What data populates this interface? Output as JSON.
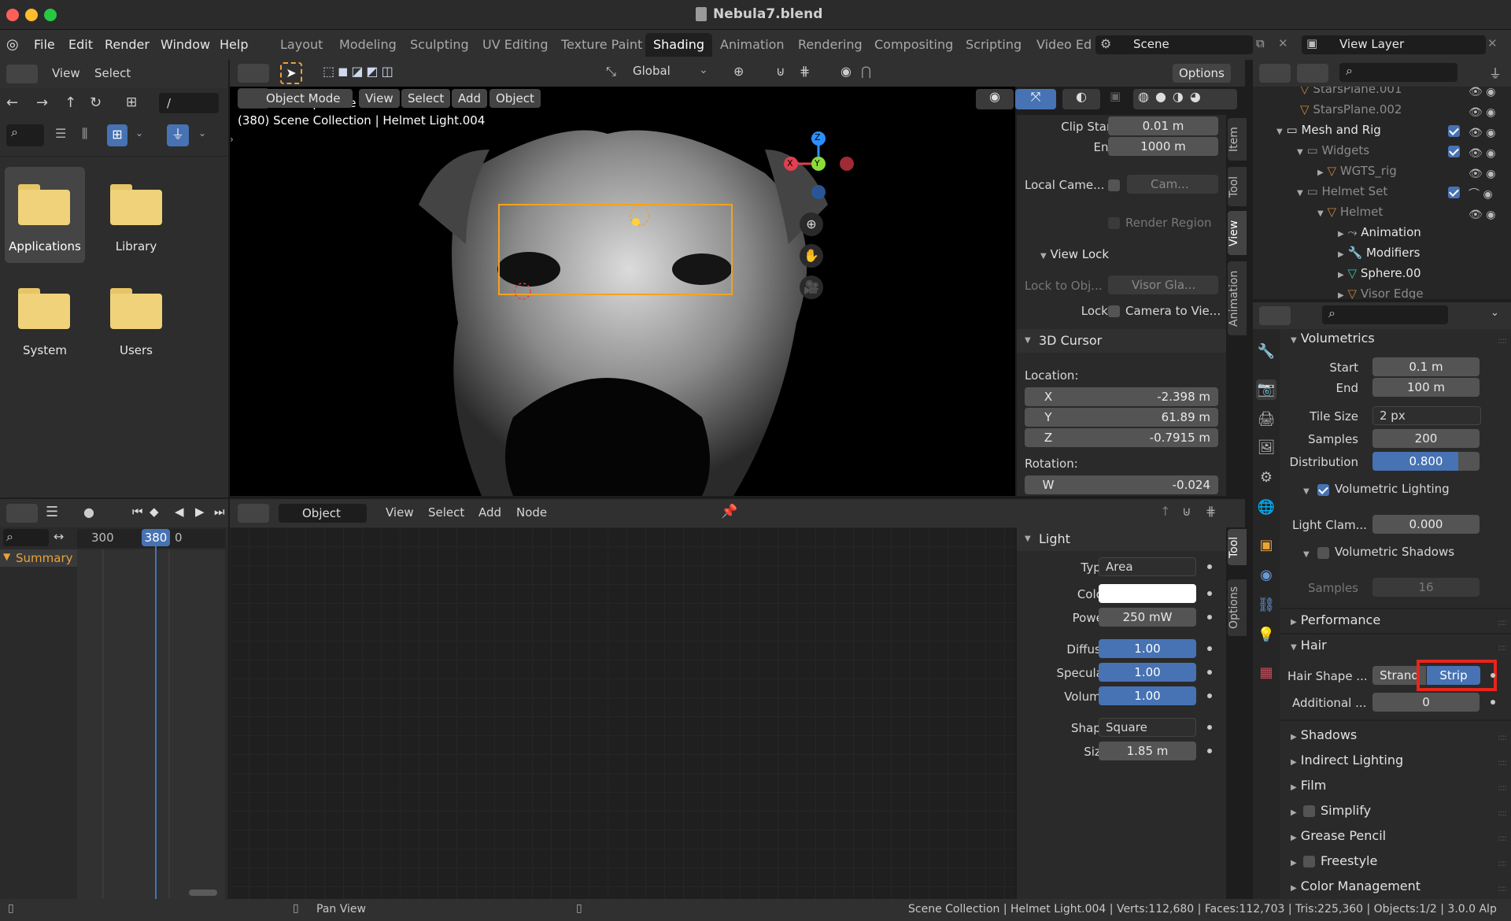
{
  "window": {
    "title": "Nebula7.blend"
  },
  "menu": [
    "File",
    "Edit",
    "Render",
    "Window",
    "Help"
  ],
  "workspaces": [
    {
      "label": "Layout",
      "active": false
    },
    {
      "label": "Modeling",
      "active": false
    },
    {
      "label": "Sculpting",
      "active": false
    },
    {
      "label": "UV Editing",
      "active": false
    },
    {
      "label": "Texture Paint",
      "active": false
    },
    {
      "label": "Shading",
      "active": true
    },
    {
      "label": "Animation",
      "active": false
    },
    {
      "label": "Rendering",
      "active": false
    },
    {
      "label": "Compositing",
      "active": false
    },
    {
      "label": "Scripting",
      "active": false
    },
    {
      "label": "Video Ed",
      "active": false
    }
  ],
  "scene": {
    "name": "Scene"
  },
  "view_layer": {
    "name": "View Layer"
  },
  "file_browser": {
    "header": {
      "view": "View",
      "select": "Select"
    },
    "path": "/",
    "items": [
      {
        "label": "Applications",
        "selected": true
      },
      {
        "label": "Library",
        "selected": false
      },
      {
        "label": "System",
        "selected": false
      },
      {
        "label": "Users",
        "selected": false
      }
    ]
  },
  "viewport": {
    "toolbar": {
      "orientation": "Global",
      "options": "Options"
    },
    "header": {
      "mode": "Object Mode",
      "view": "View",
      "select": "Select",
      "add": "Add",
      "object": "Object"
    },
    "overlay_lines": [
      "Camera Perspective",
      "(380) Scene Collection | Helmet Light.004"
    ],
    "gizmo": {
      "x": "X",
      "y": "Y",
      "z": "Z"
    },
    "sidebar": {
      "tabs": [
        "Item",
        "Tool",
        "View",
        "Animation"
      ],
      "clip_start_label": "Clip Start",
      "clip_start": "0.01 m",
      "clip_end_label": "End",
      "clip_end": "1000 m",
      "local_camera_label": "Local Came...",
      "local_camera_value": "Cam...",
      "render_region": "Render Region",
      "view_lock": "View Lock",
      "lock_to_obj_label": "Lock to Obj...",
      "lock_to_obj_value": "Visor Gla...",
      "lock_label": "Lock",
      "camera_to_view": "Camera to Vie...",
      "cursor_title": "3D Cursor",
      "location_label": "Location:",
      "x_label": "X",
      "x": "-2.398 m",
      "y_label": "Y",
      "y": "61.89 m",
      "z_label": "Z",
      "z": "-0.7915 m",
      "rotation_label": "Rotation:",
      "w_label": "W",
      "w": "-0.024"
    }
  },
  "timeline": {
    "frame_a": "300",
    "current": "380",
    "frame_b": "0",
    "summary": "Summary"
  },
  "node_editor": {
    "header": {
      "type": "Object",
      "view": "View",
      "select": "Select",
      "add": "Add",
      "node": "Node"
    },
    "tabs": [
      "Tool",
      "Options"
    ],
    "light": {
      "title": "Light",
      "type_label": "Type",
      "type": "Area",
      "color_label": "Color",
      "color": "#ffffff",
      "power_label": "Power",
      "power": "250 mW",
      "diffuse_label": "Diffuse",
      "diffuse": "1.00",
      "specular_label": "Specular",
      "specular": "1.00",
      "volume_label": "Volume",
      "volume": "1.00",
      "shape_label": "Shape",
      "shape": "Square",
      "size_label": "Size",
      "size": "1.85 m"
    }
  },
  "outliner": {
    "rows": [
      {
        "label": "StarsPlane.001",
        "dim": true
      },
      {
        "label": "StarsPlane.002",
        "dim": true
      },
      {
        "label": "Mesh and Rig",
        "dim": false
      },
      {
        "label": "Widgets",
        "dim": true
      },
      {
        "label": "WGTS_rig",
        "dim": true
      },
      {
        "label": "Helmet Set",
        "dim": true
      },
      {
        "label": "Helmet",
        "dim": true
      },
      {
        "label": "Animation",
        "dim": false
      },
      {
        "label": "Modifiers",
        "dim": false
      },
      {
        "label": "Sphere.00",
        "dim": false
      },
      {
        "label": "Visor Edge",
        "dim": true
      }
    ]
  },
  "properties": {
    "volumetrics": "Volumetrics",
    "start_label": "Start",
    "start": "0.1 m",
    "end_label": "End",
    "end": "100 m",
    "tile_size_label": "Tile Size",
    "tile_size": "2 px",
    "samples_label": "Samples",
    "samples": "200",
    "distribution_label": "Distribution",
    "distribution": "0.800",
    "distribution_fraction": 0.8,
    "vol_lighting": "Volumetric Lighting",
    "light_clamp_label": "Light Clam...",
    "light_clamp": "0.000",
    "vol_shadows": "Volumetric Shadows",
    "shadow_samples_label": "Samples",
    "shadow_samples": "16",
    "performance": "Performance",
    "hair": "Hair",
    "hair_shape_label": "Hair Shape ...",
    "hair_strand": "Strand",
    "hair_strip": "Strip",
    "additional_label": "Additional ...",
    "additional": "0",
    "shadows": "Shadows",
    "indirect": "Indirect Lighting",
    "film": "Film",
    "simplify": "Simplify",
    "grease_pencil": "Grease Pencil",
    "freestyle": "Freestyle",
    "color_management": "Color Management"
  },
  "status_bar": {
    "pan": "Pan View",
    "info": "Scene Collection | Helmet Light.004 | Verts:112,680 | Faces:112,703 | Tris:225,360 | Objects:1/2 | 3.0.0 Alp"
  }
}
